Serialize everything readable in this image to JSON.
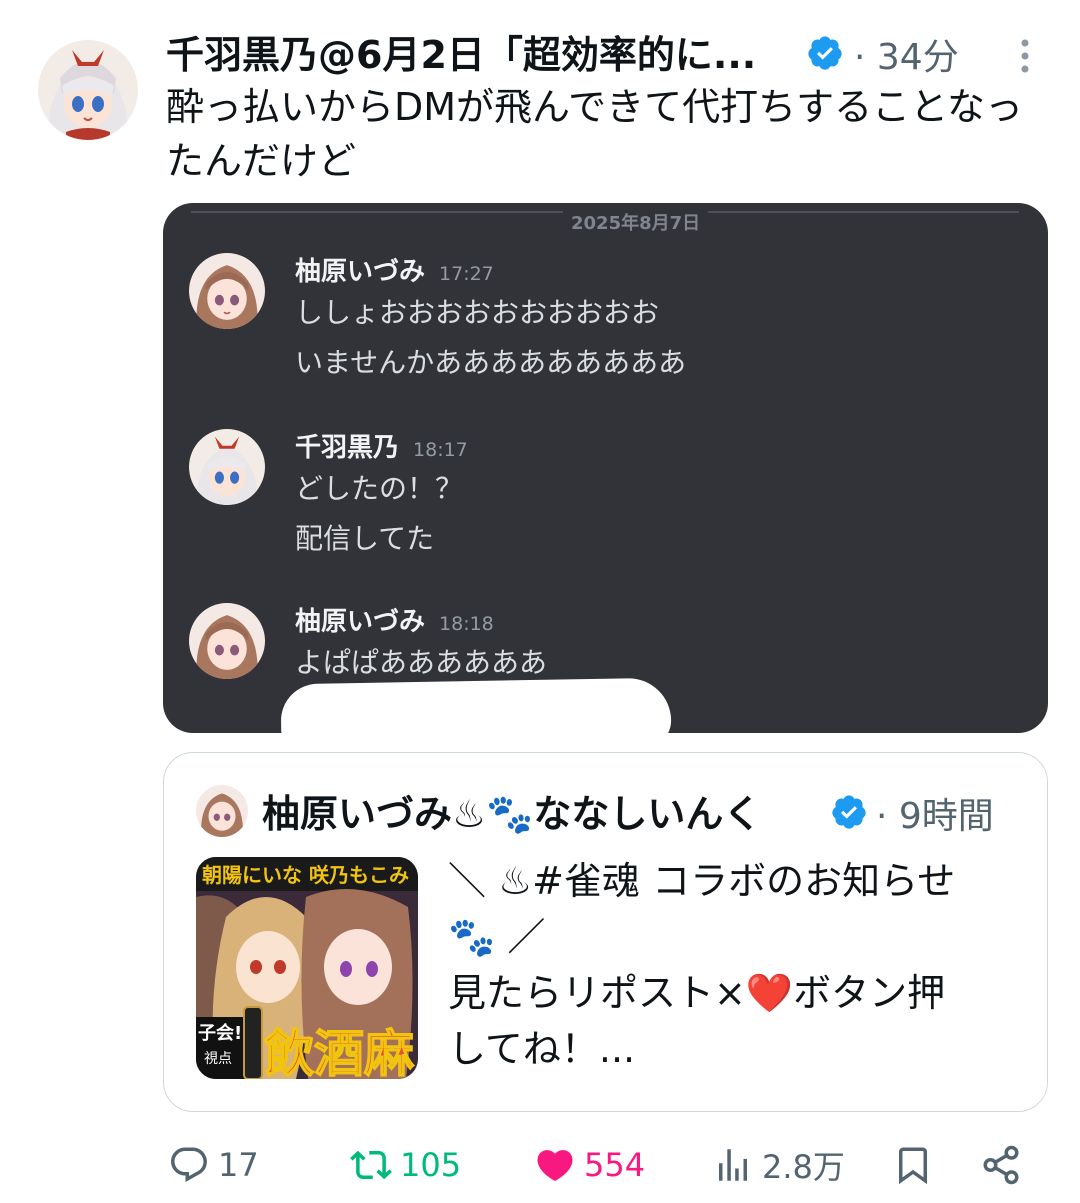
{
  "tweet": {
    "author": "千羽黒乃@6月2日「超効率的に...",
    "time": "34分",
    "text": "酔っ払いからDMが飛んできて代打ちすることなったんだけど"
  },
  "dm": {
    "date": "2025年8月7日",
    "messages": [
      {
        "name": "柚原いづみ",
        "time": "17:27",
        "lines": [
          "ししょおおおおおおおおおお",
          "いませんかあああああああああ"
        ]
      },
      {
        "name": "千羽黒乃",
        "time": "18:17",
        "lines": [
          "どしたの！？",
          "配信してた"
        ]
      },
      {
        "name": "柚原いづみ",
        "time": "18:18",
        "lines": [
          "よぱぱああああああ"
        ]
      }
    ]
  },
  "quote": {
    "author": "柚原いづみ♨🐾ななしいんく",
    "time": "9時間",
    "text_lines": [
      "＼ ♨#雀魂 コラボのお知らせ",
      "🐾 ／",
      "見たらリポスト×❤️ボタン押",
      "してね！..."
    ],
    "thumbnail_banner": "朝陽にいな 咲乃もこみ",
    "thumbnail_left": "子会!!",
    "thumbnail_sub": "視点",
    "thumbnail_big": "飲酒麻"
  },
  "actions": {
    "replies": "17",
    "retweets": "105",
    "likes": "554",
    "views": "2.8万"
  },
  "colors": {
    "accent": "#1d9bf0",
    "retweet": "#00ba7c",
    "like": "#f91880",
    "dm_bg": "#313338"
  }
}
